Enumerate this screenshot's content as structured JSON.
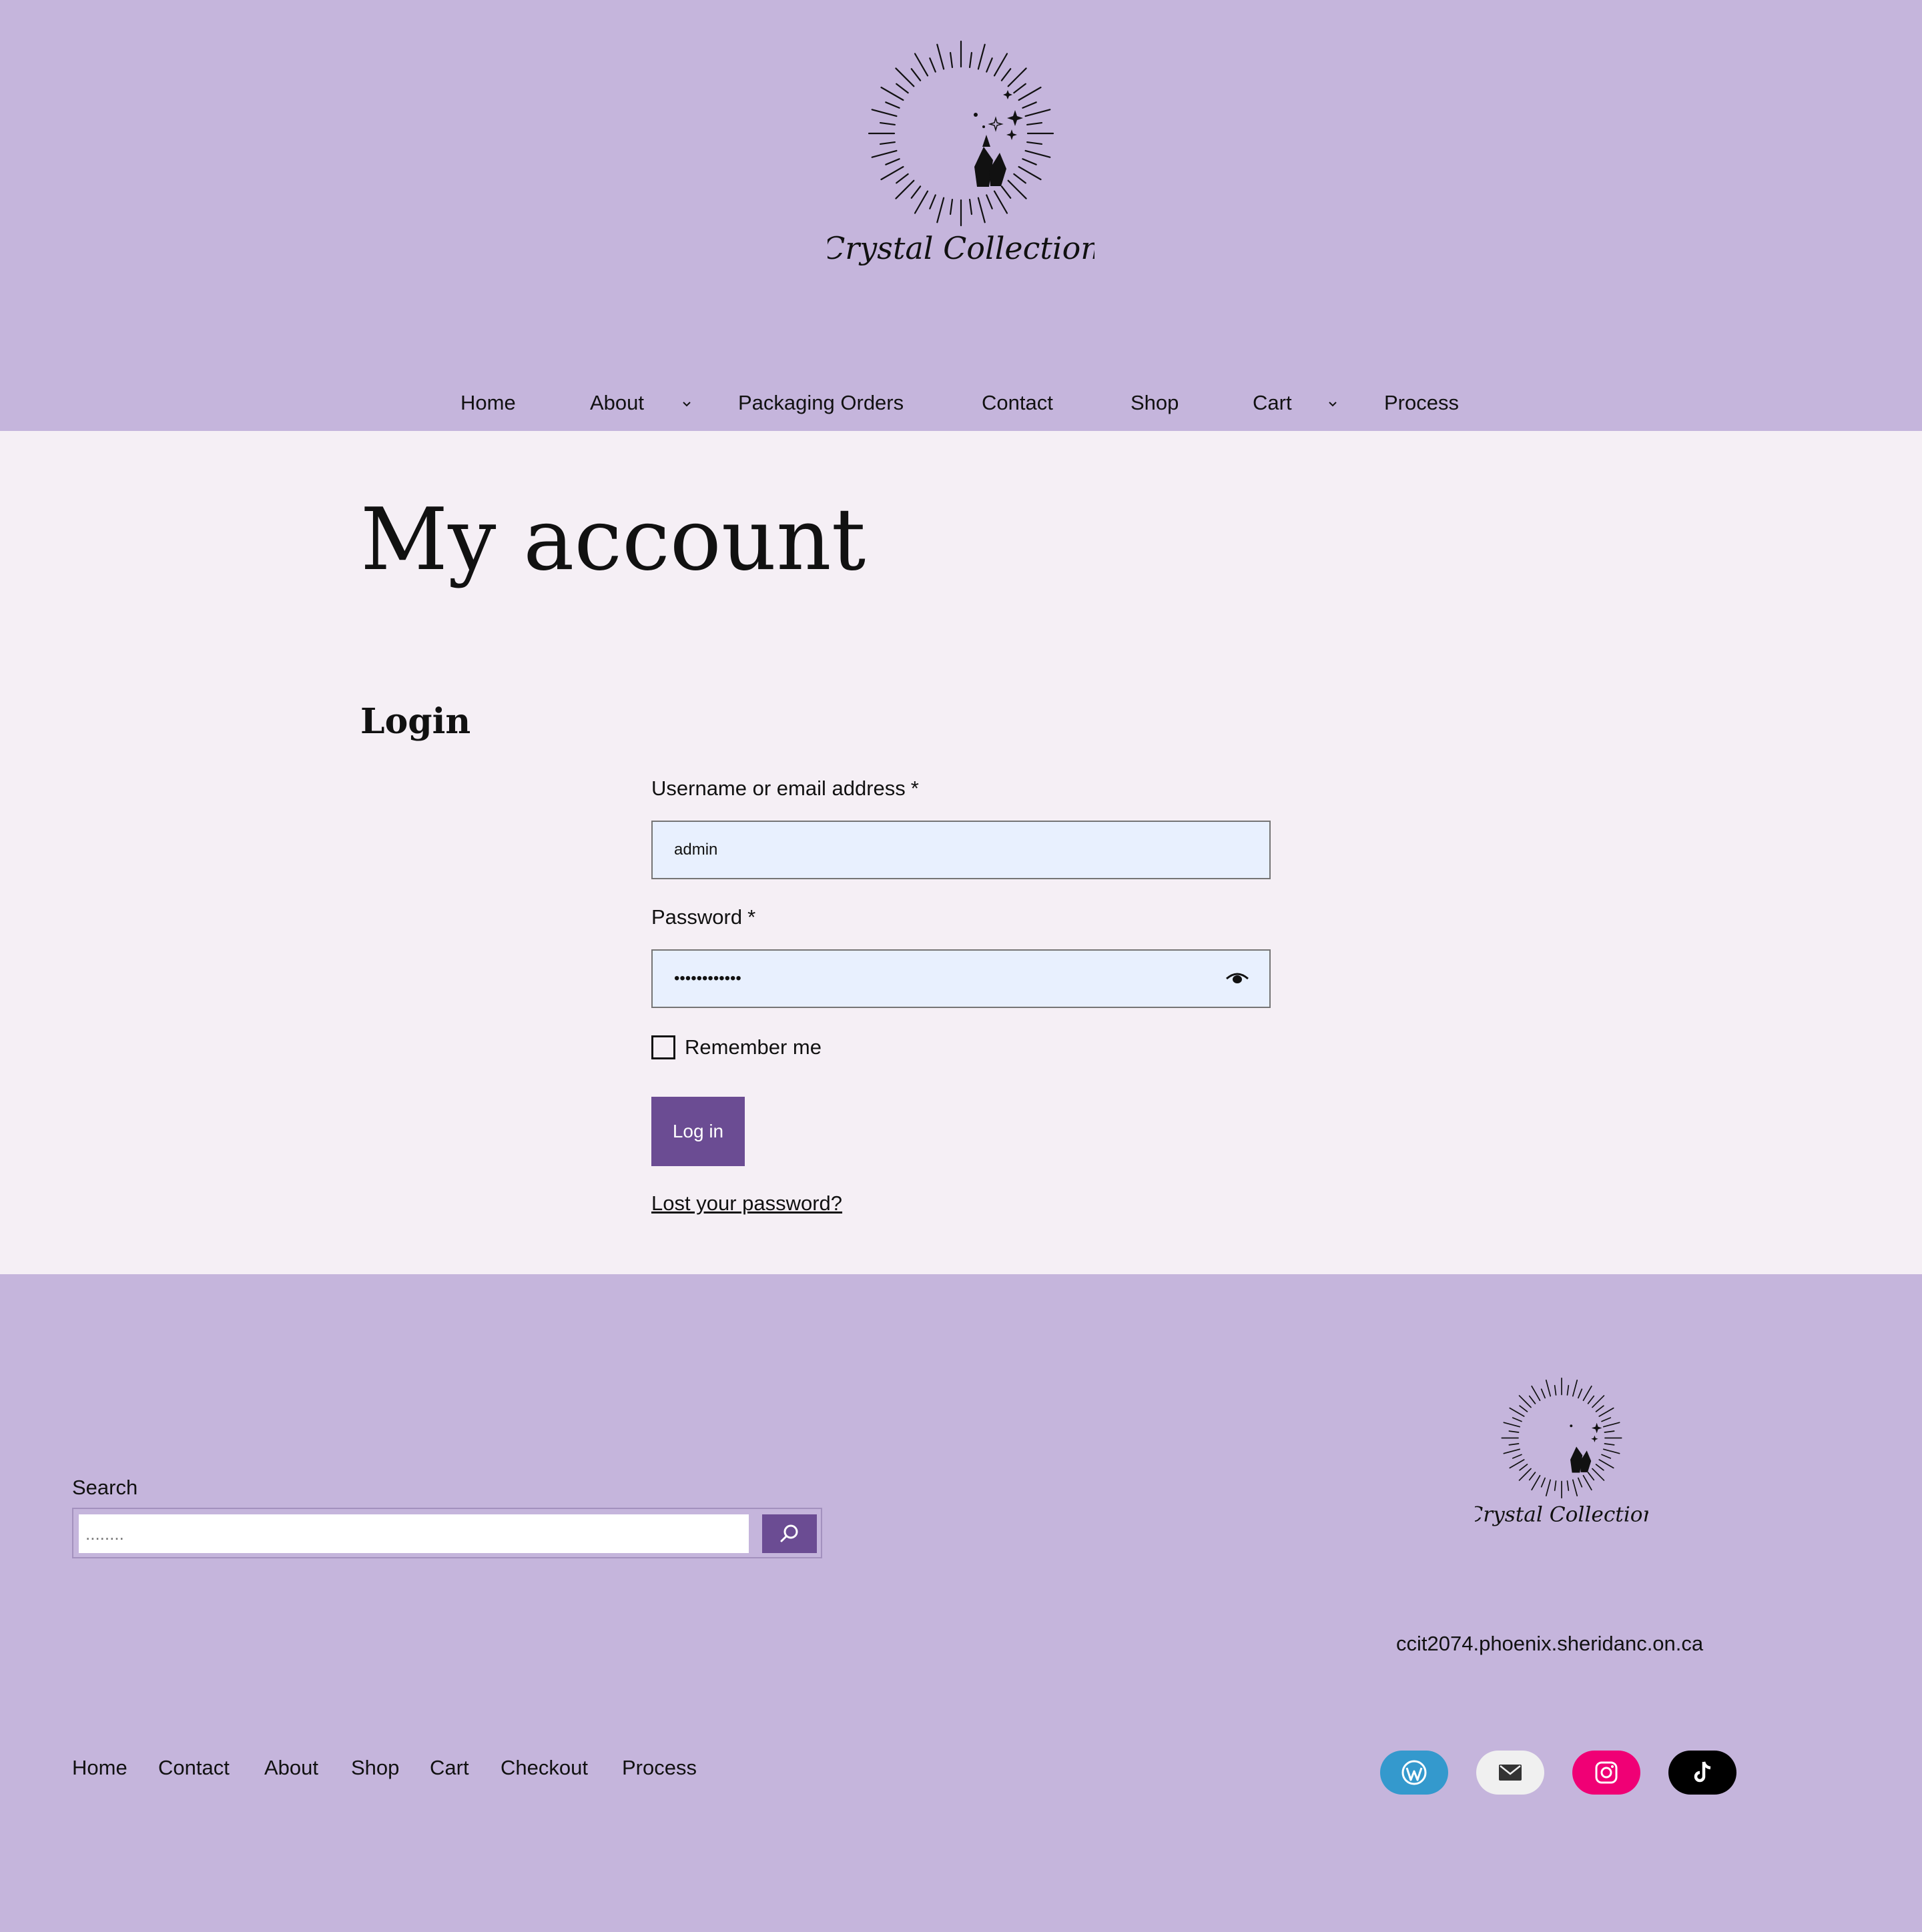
{
  "brand": {
    "logo_text": "Crystal Collection"
  },
  "nav": {
    "items": [
      {
        "label": "Home",
        "has_submenu": false
      },
      {
        "label": "About",
        "has_submenu": true
      },
      {
        "label": "Packaging Orders",
        "has_submenu": false
      },
      {
        "label": "Contact",
        "has_submenu": false
      },
      {
        "label": "Shop",
        "has_submenu": false
      },
      {
        "label": "Cart",
        "has_submenu": true
      },
      {
        "label": "Process",
        "has_submenu": false
      }
    ]
  },
  "main": {
    "page_title": "My account",
    "section_title": "Login",
    "username": {
      "label": "Username or email address",
      "required_mark": "*",
      "value": "admin"
    },
    "password": {
      "label": "Password",
      "required_mark": "*",
      "value": "••••••••••••",
      "toggle_icon": "eye-icon"
    },
    "remember": {
      "label": "Remember me",
      "checked": false
    },
    "login_button": "Log in",
    "lost_password_link": "Lost your password?"
  },
  "footer": {
    "search": {
      "label": "Search",
      "placeholder": "........",
      "button_icon": "search-icon"
    },
    "logo_text": "Crystal Collection",
    "site_url": "ccit2074.phoenix.sheridanc.on.ca",
    "nav": [
      "Home",
      "Contact",
      "About",
      "Shop",
      "Cart",
      "Checkout",
      "Process"
    ],
    "social": [
      {
        "name": "wordpress-icon",
        "bg": "#3499cd"
      },
      {
        "name": "mail-icon",
        "bg": "#f0f0f0"
      },
      {
        "name": "instagram-icon",
        "bg": "#f00075"
      },
      {
        "name": "tiktok-icon",
        "bg": "#000000"
      }
    ]
  },
  "colors": {
    "header_bg": "#c5b5dc",
    "main_bg": "#f5eff5",
    "accent": "#6b4c93",
    "input_bg": "#e8f0fe"
  }
}
